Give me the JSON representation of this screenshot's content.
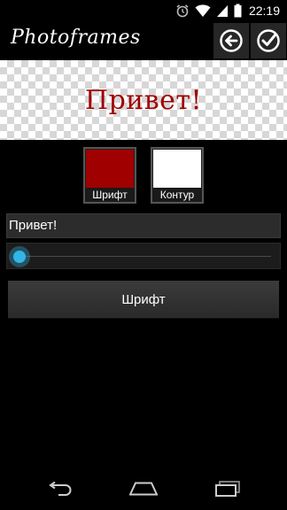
{
  "status_bar": {
    "time": "22:19"
  },
  "action_bar": {
    "app_title": "Photoframes"
  },
  "preview": {
    "text": "Привет!",
    "text_color": "#a00000"
  },
  "swatches": {
    "font": {
      "label": "Шрифт",
      "color": "#a00000"
    },
    "outline": {
      "label": "Контур",
      "color": "#ffffff"
    }
  },
  "text_input": {
    "value": "Привет!"
  },
  "size_slider": {
    "value": 0.0
  },
  "font_button": {
    "label": "Шрифт"
  },
  "colors": {
    "accent": "#33b5e5",
    "background": "#000000"
  }
}
